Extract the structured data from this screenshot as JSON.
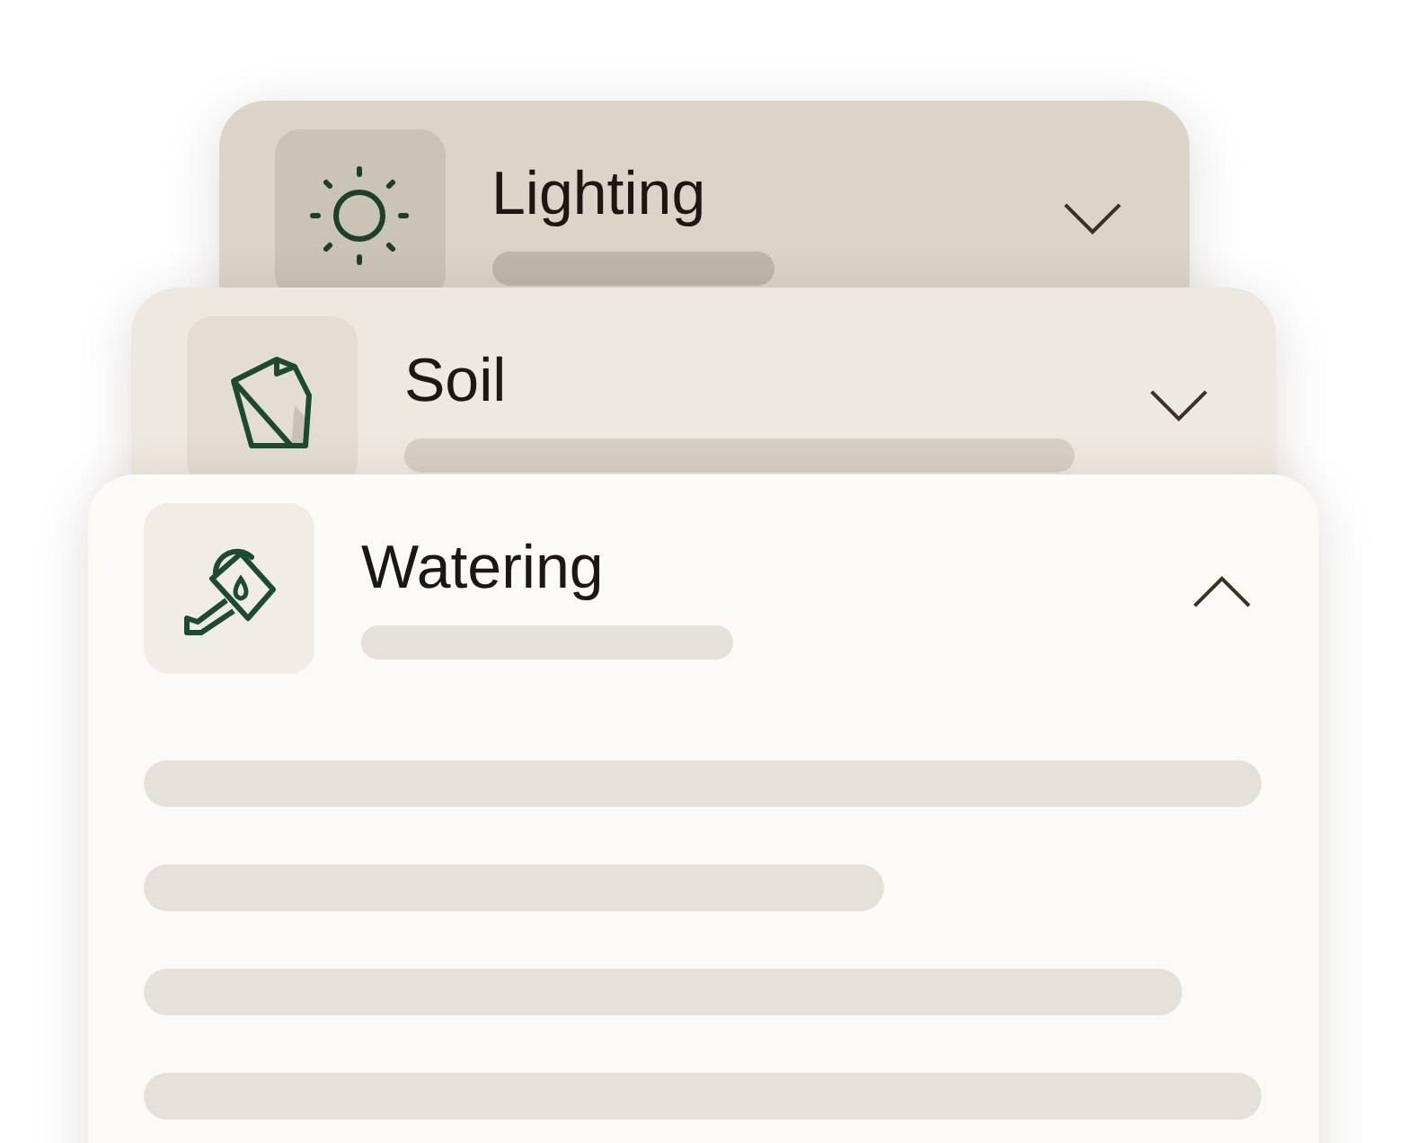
{
  "cards": [
    {
      "kind": "sun",
      "title": "Lighting",
      "expanded": false
    },
    {
      "kind": "soil",
      "title": "Soil",
      "expanded": false
    },
    {
      "kind": "watering",
      "title": "Watering",
      "expanded": true
    }
  ]
}
